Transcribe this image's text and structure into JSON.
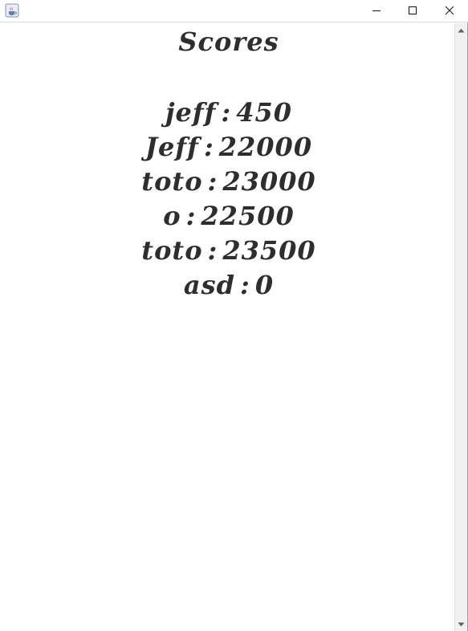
{
  "window": {
    "title": "",
    "icon": "java-cup-icon",
    "controls": {
      "minimize": "minimize-icon",
      "maximize": "maximize-icon",
      "close": "close-icon"
    }
  },
  "content": {
    "title": "Scores",
    "separator": ":",
    "scores": [
      {
        "name": "jeff",
        "score": "450"
      },
      {
        "name": "Jeff",
        "score": "22000"
      },
      {
        "name": "toto",
        "score": "23000"
      },
      {
        "name": "o",
        "score": "22500"
      },
      {
        "name": "toto",
        "score": "23500"
      },
      {
        "name": "asd",
        "score": "0"
      }
    ]
  },
  "scrollbar": {
    "up_icon": "scroll-up-arrow-icon",
    "down_icon": "scroll-down-arrow-icon"
  },
  "colors": {
    "text": "#2e2e2e",
    "background": "#ffffff",
    "scrollbar_track": "#f0f0f0"
  }
}
